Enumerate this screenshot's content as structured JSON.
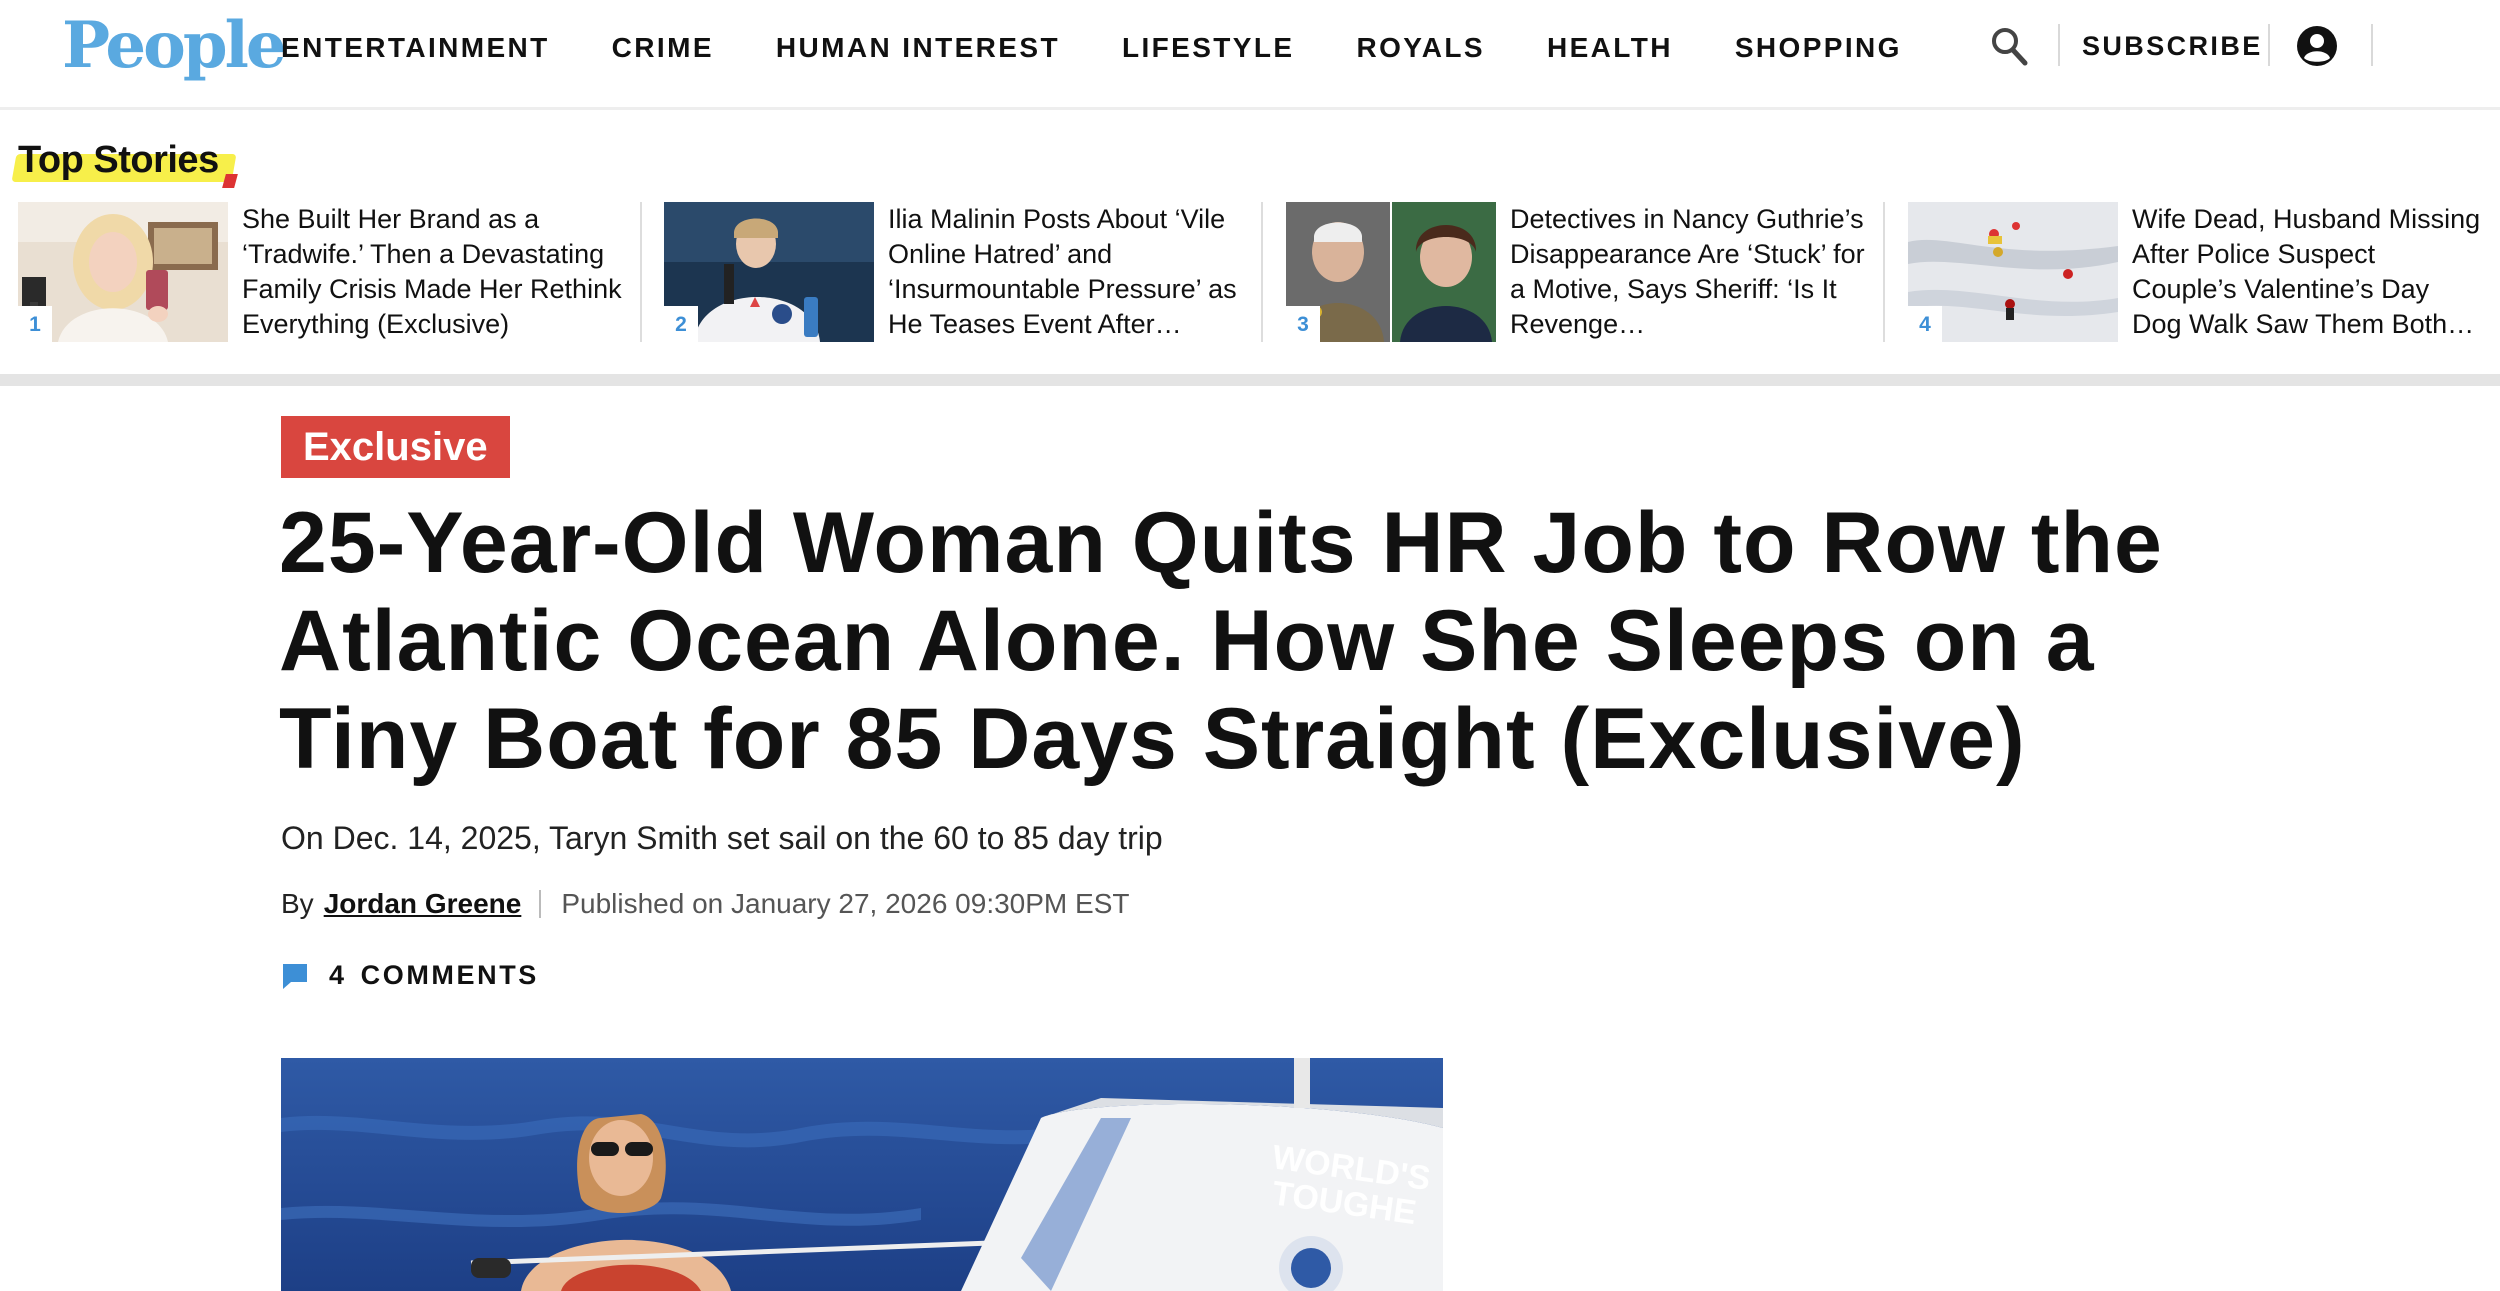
{
  "brand": {
    "logo_text": "People",
    "logo_color": "#5aa9e0"
  },
  "nav": {
    "items": [
      "ENTERTAINMENT",
      "CRIME",
      "HUMAN INTEREST",
      "LIFESTYLE",
      "ROYALS",
      "HEALTH",
      "SHOPPING"
    ],
    "search_icon": "search-icon",
    "subscribe_label": "SUBSCRIBE",
    "account_icon": "account-icon"
  },
  "top_stories": {
    "title": "Top Stories",
    "items": [
      {
        "number": "1",
        "headline": "She Built Her Brand as a ‘Tradwife.’ Then a Devastating Family Crisis Made Her Rethink Everything (Exclusive)"
      },
      {
        "number": "2",
        "headline": "Ilia Malinin Posts About ‘Vile Online Hatred’ and ‘Insurmountable Pressure’ as He Teases Event After…"
      },
      {
        "number": "3",
        "headline": "Detectives in Nancy Guthrie’s Disappearance Are ‘Stuck’ for a Motive, Says Sheriff: ‘Is It Revenge…"
      },
      {
        "number": "4",
        "headline": "Wife Dead, Husband Missing After Police Suspect Couple’s Valentine’s Day Dog Walk Saw Them Both…"
      }
    ]
  },
  "article": {
    "badge": "Exclusive",
    "badge_color": "#d9463f",
    "headline": "25-Year-Old Woman Quits HR Job to Row the Atlantic Ocean Alone. How She Sleeps on a Tiny Boat for 85 Days Straight (Exclusive)",
    "subhead": "On Dec. 14, 2025, Taryn Smith set sail on the 60 to 85 day trip",
    "by_label": "By",
    "author": "Jordan Greene",
    "published": "Published on January 27, 2026 09:30PM EST",
    "comments_count": "4",
    "comments_label": "COMMENTS",
    "comment_icon": "comment-icon",
    "hero_boat_text": "WORLD'S TOUGHE"
  }
}
